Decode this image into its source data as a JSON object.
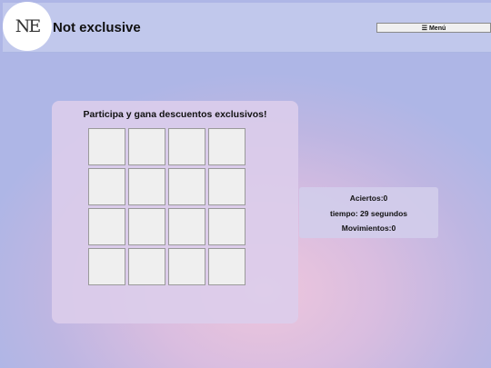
{
  "header": {
    "logo_text": "NE",
    "brand": "Not exclusive",
    "menu_label": "☰ Menú"
  },
  "game": {
    "title": "Participa y gana descuentos exclusivos!",
    "cards": [
      {
        "state": "hidden"
      },
      {
        "state": "hidden"
      },
      {
        "state": "hidden"
      },
      {
        "state": "hidden"
      },
      {
        "state": "hidden"
      },
      {
        "state": "hidden"
      },
      {
        "state": "hidden"
      },
      {
        "state": "hidden"
      },
      {
        "state": "hidden"
      },
      {
        "state": "hidden"
      },
      {
        "state": "hidden"
      },
      {
        "state": "hidden"
      },
      {
        "state": "hidden"
      },
      {
        "state": "hidden"
      },
      {
        "state": "hidden"
      },
      {
        "state": "hidden"
      }
    ]
  },
  "stats": {
    "aciertos": "Aciertos:0",
    "tiempo": "tiempo: 29 segundos",
    "movimientos": "Movimientos:0"
  }
}
